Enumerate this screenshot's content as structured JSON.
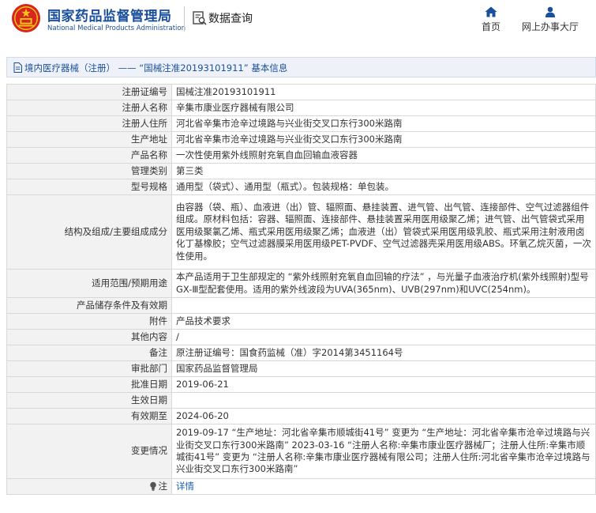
{
  "header": {
    "brand_cn": "国家药品监督管理局",
    "brand_en": "National Medical Products Administration",
    "query_label": "数据查询",
    "nav_home": "首页",
    "nav_hall": "网上办事大厅"
  },
  "title_bar": {
    "text": "境内医疗器械（注册） —— “国械注准20193101911” 基本信息"
  },
  "rows": [
    {
      "label": "注册证编号",
      "value": "国械注准20193101911"
    },
    {
      "label": "注册人名称",
      "value": "辛集市康业医疗器械有限公司"
    },
    {
      "label": "注册人住所",
      "value": "河北省辛集市沧辛过境路与兴业街交叉口东行300米路南"
    },
    {
      "label": "生产地址",
      "value": "河北省辛集市沧辛过境路与兴业街交叉口东行300米路南"
    },
    {
      "label": "产品名称",
      "value": "一次性使用紫外线照射充氧自血回输血液容器"
    },
    {
      "label": "管理类别",
      "value": "第三类"
    },
    {
      "label": "型号规格",
      "value": "通用型（袋式）、通用型（瓶式）。包装规格：单包装。"
    },
    {
      "label": "结构及组成/主要组成成分",
      "value": "由容器（袋、瓶）、血液进（出）管、辐照面、悬挂装置、进气管、出气管、连接部件、空气过滤器组件组成。原材料包括：容器、辐照面、连接部件、悬挂装置采用医用级聚乙烯；进气管、出气管袋式采用医用级聚氯乙烯、瓶式采用医用级聚乙烯；血液进（出）管袋式采用医用级乳胶、瓶式采用注射液用卤化丁基橡胶；空气过滤器膜采用医用级PET-PVDF、空气过滤器壳采用医用级ABS。环氧乙烷灭菌，一次性使用。"
    },
    {
      "label": "适用范围/预期用途",
      "value": "本产品适用于卫生部规定的 “紫外线照射充氧自血回输的疗法” ，与光量子血液治疗机(紫外线照射)型号GX-Ⅲ型配套使用。适用的紫外线波段为UVA(365nm)、UVB(297nm)和UVC(254nm)。"
    },
    {
      "label": "产品储存条件及有效期",
      "value": ""
    },
    {
      "label": "附件",
      "value": "产品技术要求"
    },
    {
      "label": "其他内容",
      "value": "/"
    },
    {
      "label": "备注",
      "value": "原注册证编号：国食药监械（准）字2014第3451164号"
    },
    {
      "label": "审批部门",
      "value": "国家药品监督管理局"
    },
    {
      "label": "批准日期",
      "value": "2019-06-21"
    },
    {
      "label": "生效日期",
      "value": ""
    },
    {
      "label": "有效期至",
      "value": "2024-06-20"
    },
    {
      "label": "变更情况",
      "value": "2019-09-17 “生产地址：河北省辛集市顺城街41号” 变更为 “生产地址：河北省辛集市沧辛过境路与兴业街交叉口东行300米路南” 2023-03-16 “注册人名称:辛集市康业医疗器械厂；注册人住所:辛集市顺城街41号” 变更为 “注册人名称:辛集市康业医疗器械有限公司；注册人住所:河北省辛集市沧辛过境路与兴业街交叉口东行300米路南”"
    },
    {
      "label": "注",
      "value": "详情"
    }
  ]
}
